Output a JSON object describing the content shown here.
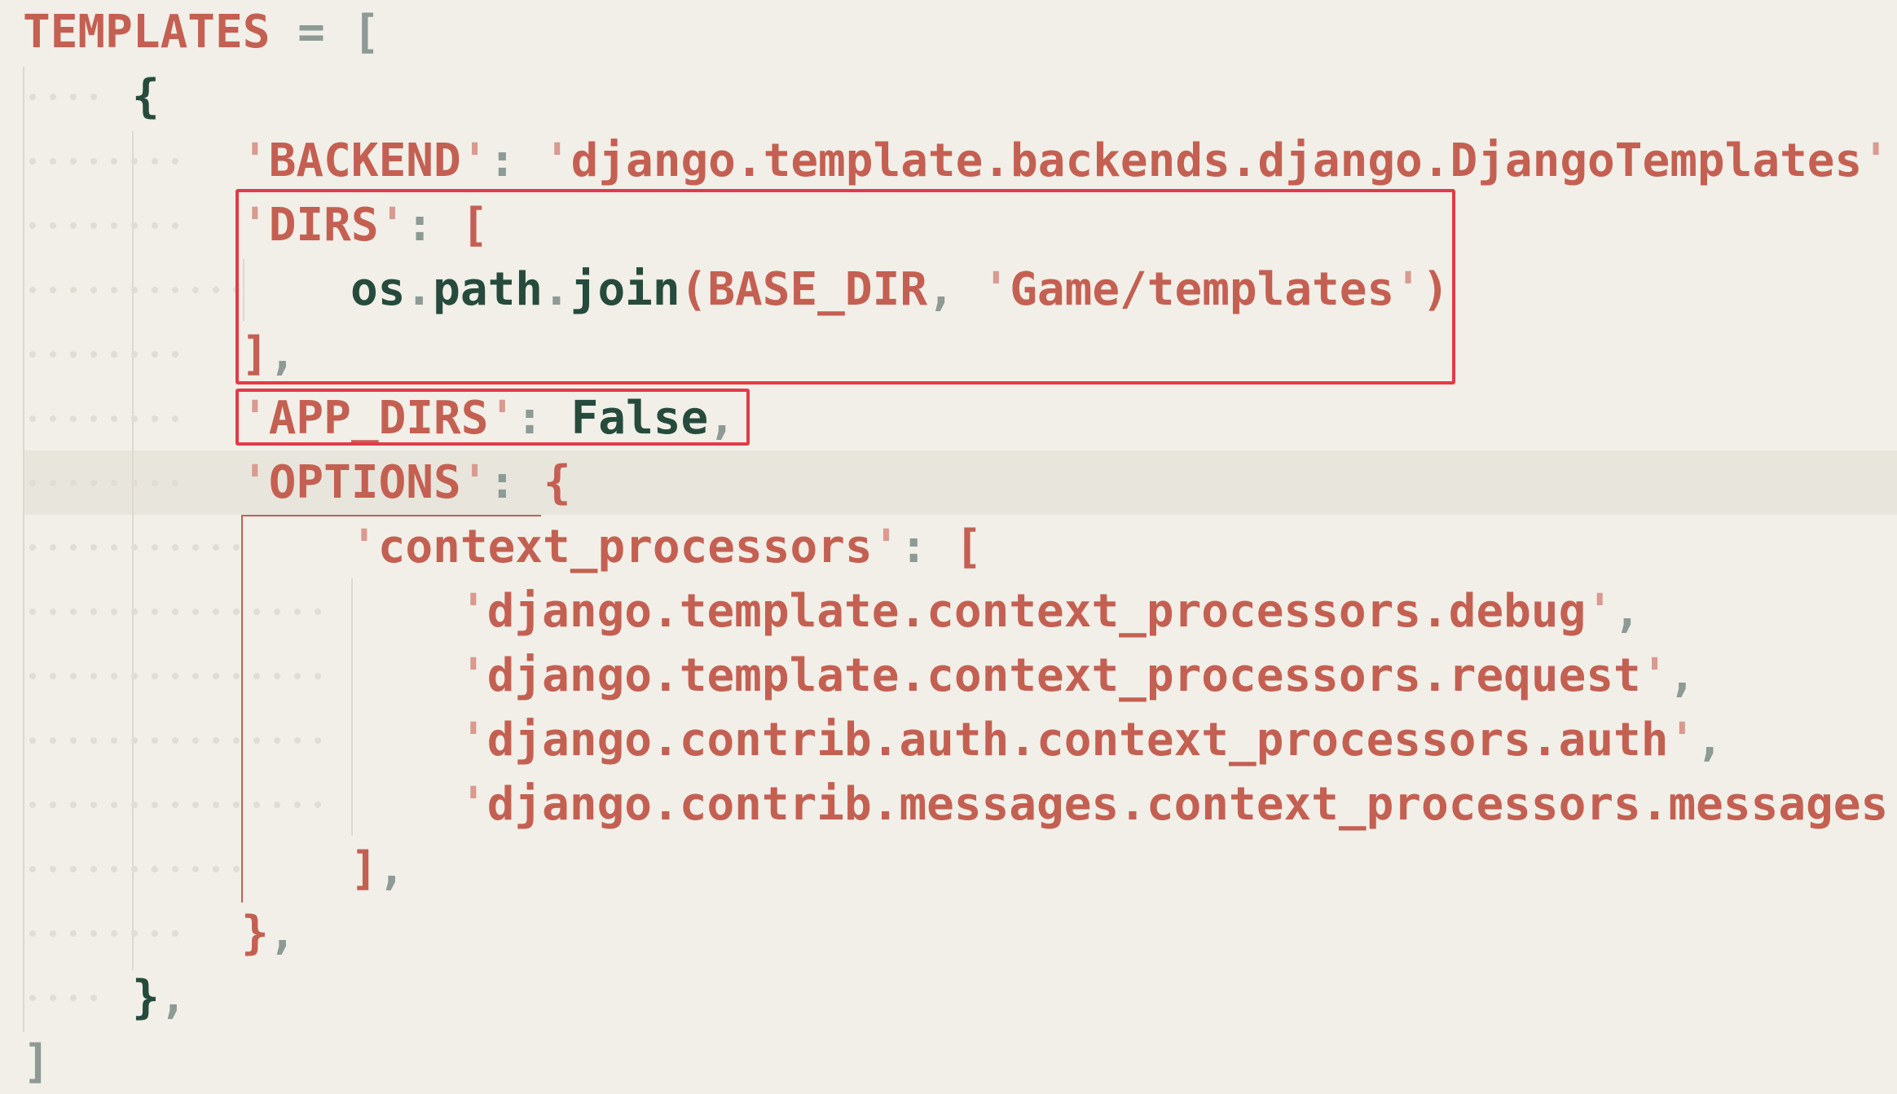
{
  "editor": {
    "lines": [
      {
        "tokens": [
          {
            "t": "TEMPLATES",
            "c": "var"
          },
          {
            "t": " = ",
            "c": "punct"
          },
          {
            "t": "[",
            "c": "punct"
          }
        ]
      },
      {
        "tokens": [
          {
            "t": "{",
            "c": "brace"
          }
        ]
      },
      {
        "tokens": [
          {
            "t": "'",
            "c": "quote"
          },
          {
            "t": "BACKEND",
            "c": "str"
          },
          {
            "t": "'",
            "c": "quote"
          },
          {
            "t": ": ",
            "c": "punct"
          },
          {
            "t": "'",
            "c": "quote"
          },
          {
            "t": "django.template.backends.django.DjangoTemplates",
            "c": "str"
          },
          {
            "t": "'",
            "c": "quote"
          },
          {
            "t": ",",
            "c": "punct"
          }
        ]
      },
      {
        "tokens": [
          {
            "t": "'",
            "c": "quote"
          },
          {
            "t": "DIRS",
            "c": "str"
          },
          {
            "t": "'",
            "c": "quote"
          },
          {
            "t": ": ",
            "c": "punct"
          },
          {
            "t": "[",
            "c": "brace-red"
          }
        ]
      },
      {
        "tokens": [
          {
            "t": "os",
            "c": "name"
          },
          {
            "t": ".",
            "c": "punct"
          },
          {
            "t": "path",
            "c": "name"
          },
          {
            "t": ".",
            "c": "punct"
          },
          {
            "t": "join",
            "c": "name"
          },
          {
            "t": "(",
            "c": "brace-red"
          },
          {
            "t": "BASE_DIR",
            "c": "var"
          },
          {
            "t": ", ",
            "c": "punct"
          },
          {
            "t": "'",
            "c": "quote"
          },
          {
            "t": "Game/templates",
            "c": "str"
          },
          {
            "t": "'",
            "c": "quote"
          },
          {
            "t": ")",
            "c": "brace-red"
          }
        ]
      },
      {
        "tokens": [
          {
            "t": "]",
            "c": "brace-red"
          },
          {
            "t": ",",
            "c": "punct"
          }
        ]
      },
      {
        "tokens": [
          {
            "t": "'",
            "c": "quote"
          },
          {
            "t": "APP_DIRS",
            "c": "str"
          },
          {
            "t": "'",
            "c": "quote"
          },
          {
            "t": ": ",
            "c": "punct"
          },
          {
            "t": "False",
            "c": "const"
          },
          {
            "t": ",",
            "c": "punct"
          }
        ]
      },
      {
        "tokens": [
          {
            "t": "'",
            "c": "quote"
          },
          {
            "t": "OPTIONS",
            "c": "str"
          },
          {
            "t": "'",
            "c": "quote"
          },
          {
            "t": ": ",
            "c": "punct"
          },
          {
            "t": "{",
            "c": "brace-red"
          }
        ]
      },
      {
        "tokens": [
          {
            "t": "'",
            "c": "quote"
          },
          {
            "t": "context_processors",
            "c": "str"
          },
          {
            "t": "'",
            "c": "quote"
          },
          {
            "t": ": ",
            "c": "punct"
          },
          {
            "t": "[",
            "c": "brace-red"
          }
        ]
      },
      {
        "tokens": [
          {
            "t": "'",
            "c": "quote"
          },
          {
            "t": "django.template.context_processors.debug",
            "c": "str"
          },
          {
            "t": "'",
            "c": "quote"
          },
          {
            "t": ",",
            "c": "punct"
          }
        ]
      },
      {
        "tokens": [
          {
            "t": "'",
            "c": "quote"
          },
          {
            "t": "django.template.context_processors.request",
            "c": "str"
          },
          {
            "t": "'",
            "c": "quote"
          },
          {
            "t": ",",
            "c": "punct"
          }
        ]
      },
      {
        "tokens": [
          {
            "t": "'",
            "c": "quote"
          },
          {
            "t": "django.contrib.auth.context_processors.auth",
            "c": "str"
          },
          {
            "t": "'",
            "c": "quote"
          },
          {
            "t": ",",
            "c": "punct"
          }
        ]
      },
      {
        "tokens": [
          {
            "t": "'",
            "c": "quote"
          },
          {
            "t": "django.contrib.messages.context_processors.messages",
            "c": "str"
          },
          {
            "t": "'",
            "c": "quote"
          }
        ]
      },
      {
        "tokens": [
          {
            "t": "]",
            "c": "brace-red"
          },
          {
            "t": ",",
            "c": "punct"
          }
        ]
      },
      {
        "tokens": [
          {
            "t": "}",
            "c": "brace-red"
          },
          {
            "t": ",",
            "c": "punct"
          }
        ]
      },
      {
        "tokens": [
          {
            "t": "}",
            "c": "brace"
          },
          {
            "t": ",",
            "c": "punct"
          }
        ]
      },
      {
        "tokens": [
          {
            "t": "]",
            "c": "punct"
          }
        ]
      }
    ],
    "colors": {
      "background": "#f1efe8",
      "string": "#c46052",
      "name": "#264b3d",
      "punctuation": "#8d9a95",
      "highlight_box": "#e23b48"
    }
  }
}
